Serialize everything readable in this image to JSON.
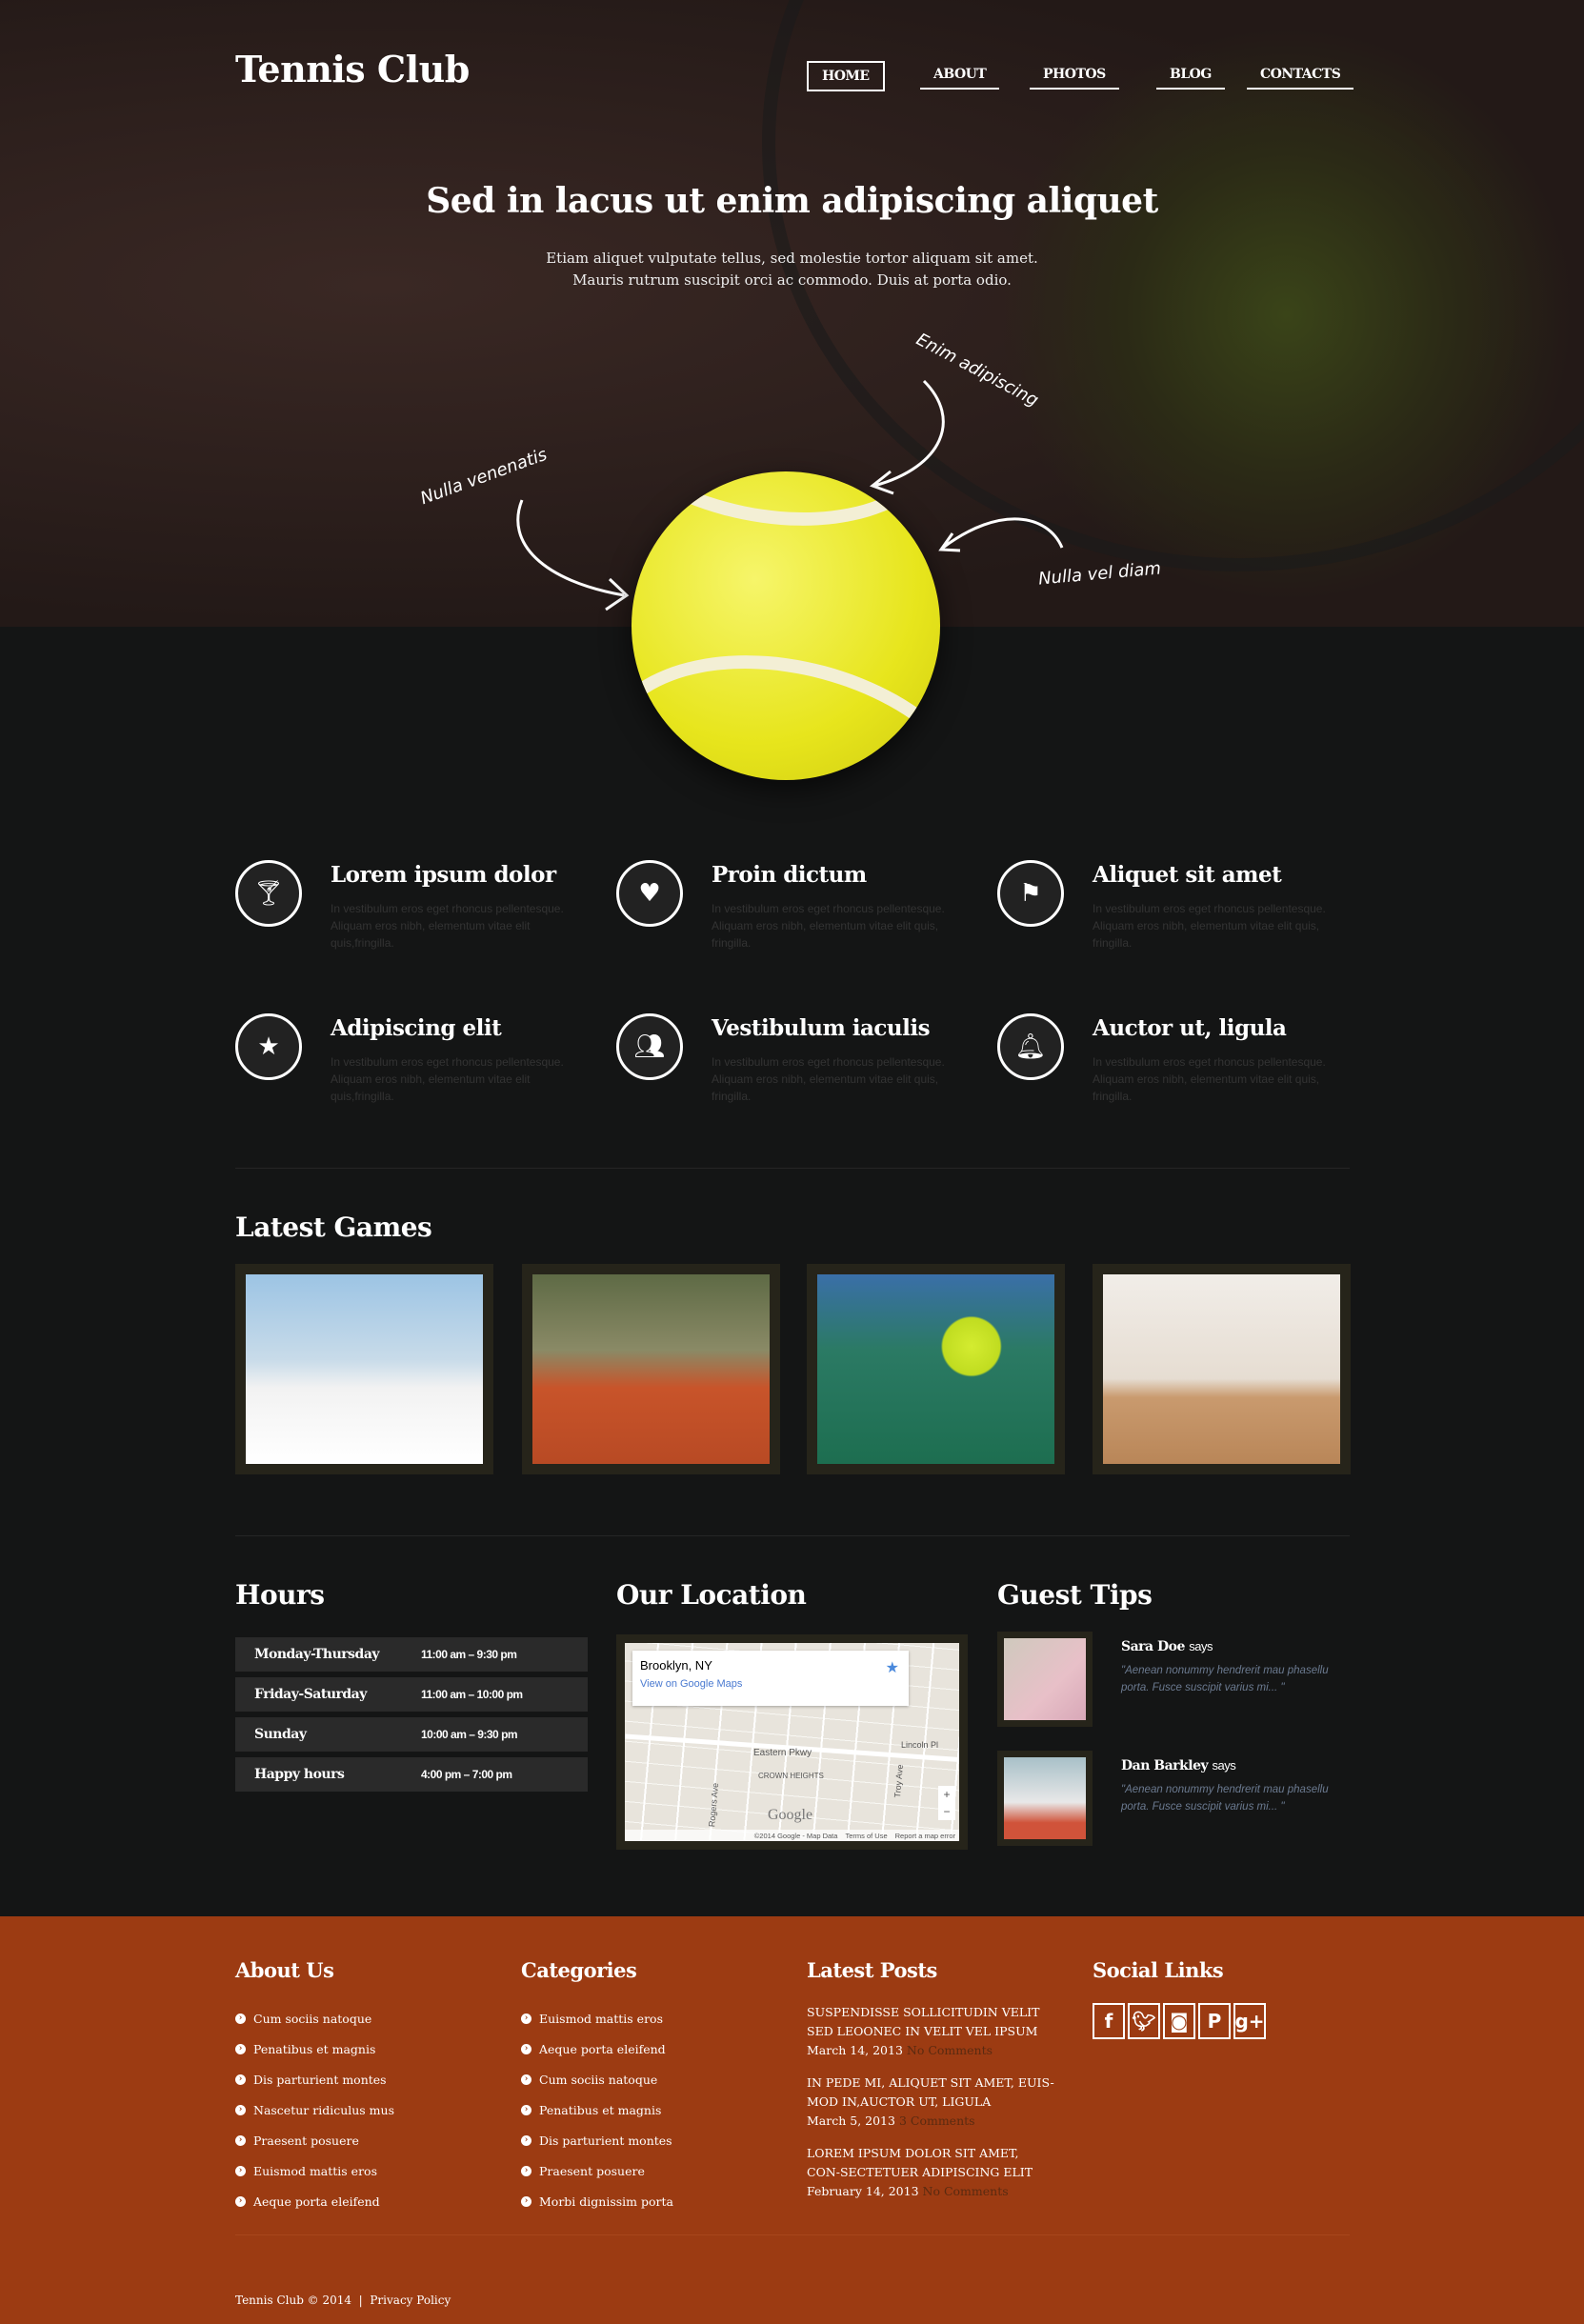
{
  "header": {
    "logo": "Tennis Club",
    "nav": [
      "HOME",
      "ABOUT",
      "PHOTOS",
      "BLOG",
      "CONTACTS"
    ],
    "active": "HOME"
  },
  "hero": {
    "title": "Sed in lacus ut enim adipiscing aliquet",
    "line1": "Etiam aliquet vulputate tellus, sed molestie tortor aliquam sit amet.",
    "line2": "Mauris rutrum suscipit orci ac commodo. Duis at porta odio.",
    "notes": [
      "Nulla venenatis",
      "Enim adipiscing",
      "Nulla vel diam"
    ]
  },
  "features": [
    {
      "icon": "cocktail-icon",
      "title": "Lorem ipsum dolor",
      "text": "In vestibulum eros eget rhoncus pellentesque. Aliquam eros nibh, elementum vitae elit quis,fringilla."
    },
    {
      "icon": "heart-icon",
      "title": "Proin dictum",
      "text": "In vestibulum eros eget rhoncus pellentesque. Aliquam eros nibh, elementum vitae elit quis, fringilla."
    },
    {
      "icon": "flag-icon",
      "title": "Aliquet sit amet",
      "text": "In vestibulum eros eget rhoncus pellentesque. Aliquam eros nibh, elementum vitae elit quis, fringilla."
    },
    {
      "icon": "star-icon",
      "title": "Adipiscing elit",
      "text": "In vestibulum eros eget rhoncus pellentesque. Aliquam eros nibh, elementum vitae elit quis,fringilla."
    },
    {
      "icon": "group-icon",
      "title": "Vestibulum iaculis",
      "text": "In vestibulum eros eget rhoncus pellentesque. Aliquam eros nibh, elementum vitae elit quis, fringilla."
    },
    {
      "icon": "bell-icon",
      "title": "Auctor ut, ligula",
      "text": "In vestibulum eros eget rhoncus pellentesque. Aliquam eros nibh, elementum vitae elit quis, fringilla."
    }
  ],
  "games": {
    "title": "Latest Games"
  },
  "hours": {
    "title": "Hours",
    "rows": [
      {
        "day": "Monday-Thursday",
        "time": "11:00 am – 9:30 pm"
      },
      {
        "day": "Friday-Saturday",
        "time": "11:00 am – 10:00 pm"
      },
      {
        "day": "Sunday",
        "time": "10:00 am – 9:30 pm"
      },
      {
        "day": "Happy hours",
        "time": "4:00 pm – 7:00 pm"
      }
    ]
  },
  "location": {
    "title": "Our Location",
    "place": "Brooklyn, NY",
    "link": "View on Google Maps",
    "streets": [
      "Eastern Pkwy",
      "CROWN HEIGHTS",
      "Lincoln Pl",
      "Rogers Ave",
      "Troy Ave"
    ],
    "logo": "Google",
    "attribution": "©2014 Google - Map Data",
    "terms": "Terms of Use",
    "report": "Report a map error"
  },
  "tips": {
    "title": "Guest Tips",
    "items": [
      {
        "name": "Sara Doe",
        "says": "says",
        "quote": "\"Aenean nonummy hendrerit mau phasellu porta. Fusce suscipit varius mi... \""
      },
      {
        "name": "Dan Barkley",
        "says": "says",
        "quote": "\"Aenean nonummy hendrerit mau phasellu porta. Fusce suscipit varius mi... \""
      }
    ]
  },
  "footer": {
    "about": {
      "title": "About Us",
      "items": [
        "Cum sociis natoque",
        "Penatibus et magnis",
        "Dis parturient montes",
        "Nascetur ridiculus mus",
        "Praesent posuere",
        "Euismod mattis eros",
        "Aeque porta eleifend"
      ]
    },
    "categories": {
      "title": "Categories",
      "items": [
        "Euismod mattis eros",
        "Aeque porta eleifend",
        "Cum sociis natoque",
        "Penatibus et magnis",
        "Dis parturient montes",
        "Praesent posuere",
        "Morbi dignissim porta"
      ]
    },
    "posts": {
      "title": "Latest Posts",
      "items": [
        {
          "title": "Suspendisse sollicitudin velit sed leoonec in velit vel ipsum",
          "date": "March 14, 2013",
          "comments": "No Comments"
        },
        {
          "title": "In pede mi, aliquet sit amet, euis-mod in,auctor ut, ligula",
          "date": "March 5, 2013",
          "comments": "3 Comments"
        },
        {
          "title": "Lorem ipsum dolor sit amet, con-sectetuer adipiscing elit",
          "date": "February 14, 2013",
          "comments": "No Comments"
        }
      ]
    },
    "social": {
      "title": "Social Links",
      "icons": [
        "facebook-icon",
        "twitter-icon",
        "instagram-icon",
        "pinterest-icon",
        "google-plus-icon"
      ]
    },
    "copyright": "Tennis Club © 2014",
    "privacy": "Privacy Policy"
  },
  "colors": {
    "footer": "#9c3b12",
    "ball": "#e7e51c"
  }
}
